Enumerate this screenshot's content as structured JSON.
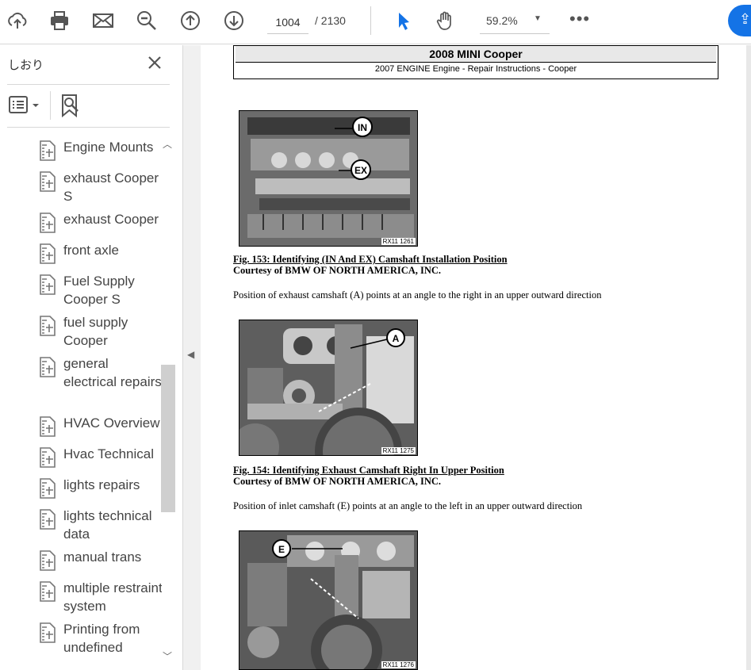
{
  "toolbar": {
    "page_current": "1004",
    "page_total": "/ 2130",
    "zoom": "59.2%",
    "more": "•••"
  },
  "sidebar": {
    "title": "しおり",
    "bookmarks": [
      {
        "label": "Engine Mounts"
      },
      {
        "label": "exhaust Cooper S"
      },
      {
        "label": "exhaust Cooper"
      },
      {
        "label": "front axle"
      },
      {
        "label": "Fuel Supply Cooper S"
      },
      {
        "label": "fuel supply Cooper"
      },
      {
        "label": "general electrical repairs"
      },
      {
        "label": "HVAC Overview"
      },
      {
        "label": "Hvac Technical"
      },
      {
        "label": "lights repairs"
      },
      {
        "label": "lights technical data"
      },
      {
        "label": "manual trans"
      },
      {
        "label": "multiple restraint system"
      },
      {
        "label": "Printing from undefined"
      }
    ]
  },
  "document": {
    "header_title": "2008 MINI Cooper",
    "header_sub": "2007 ENGINE Engine - Repair Instructions - Cooper",
    "figures": [
      {
        "callouts": [
          "IN",
          "EX"
        ],
        "code": "RX11 1261",
        "caption_title": "Fig. 153: Identifying (IN And EX) Camshaft Installation Position",
        "caption_credit": "Courtesy of BMW OF NORTH AMERICA, INC.",
        "para_after": "Position of exhaust camshaft (A) points at an angle to the right in an upper outward direction"
      },
      {
        "callouts": [
          "A"
        ],
        "code": "RX11 1275",
        "caption_title": "Fig. 154: Identifying Exhaust Camshaft Right In Upper Position",
        "caption_credit": "Courtesy of BMW OF NORTH AMERICA, INC.",
        "para_after": "Position of inlet camshaft (E) points at an angle to the left in an upper outward direction"
      },
      {
        "callouts": [
          "E"
        ],
        "code": "RX11 1276"
      }
    ]
  }
}
